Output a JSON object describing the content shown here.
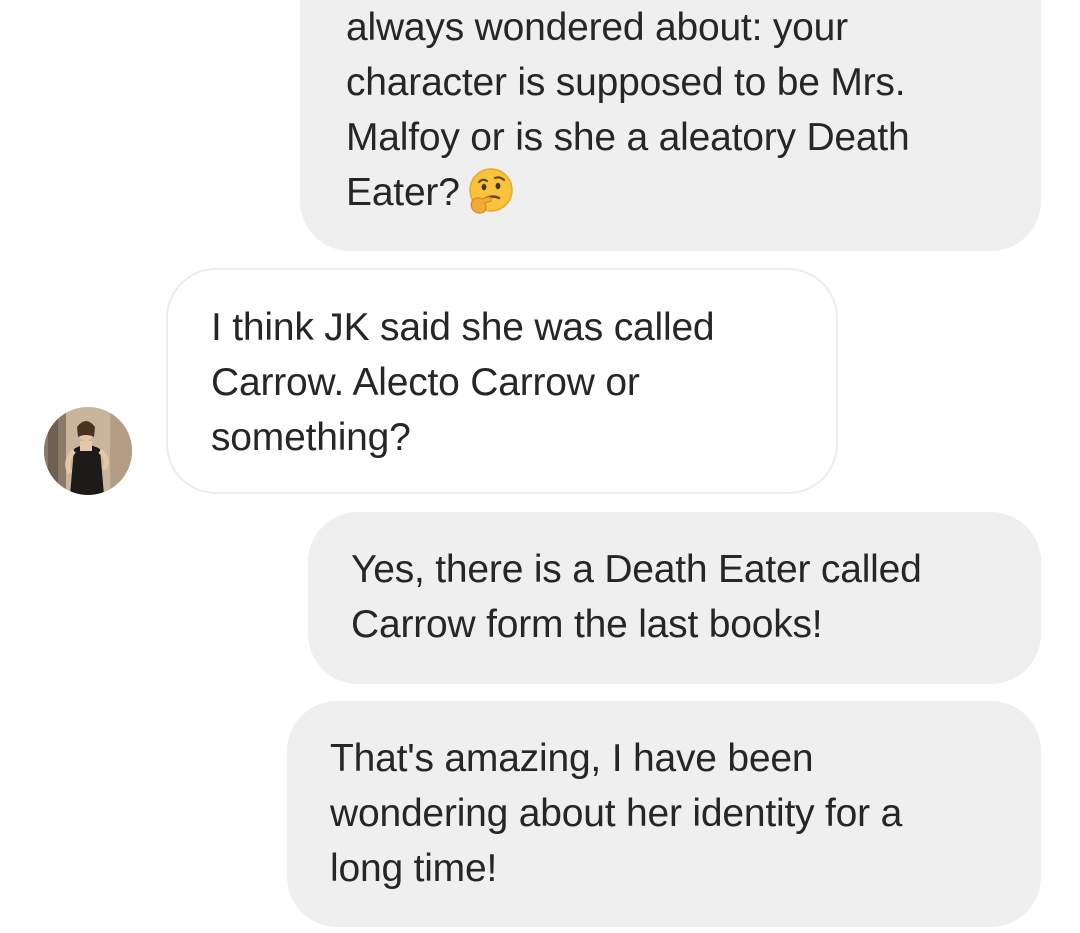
{
  "messages": [
    {
      "id": "msg1",
      "direction": "outgoing",
      "text": "always wondered about: your\ncharacter is supposed to be Mrs.\nMalfoy or is she a aleatory Death\nEater?",
      "emoji": "thinking-face-icon"
    },
    {
      "id": "msg2",
      "direction": "incoming",
      "text": "I think JK said she was called\nCarrow. Alecto Carrow or\nsomething?"
    },
    {
      "id": "msg3",
      "direction": "outgoing",
      "text": "Yes, there is a Death Eater called\nCarrow form the last books!"
    },
    {
      "id": "msg4",
      "direction": "outgoing",
      "text": "That's amazing, I have been\nwondering about her identity for a\nlong time!"
    }
  ],
  "colors": {
    "outgoing_bubble": "#efefef",
    "incoming_bubble": "#ffffff",
    "incoming_border": "#ececec",
    "text": "#262626"
  }
}
